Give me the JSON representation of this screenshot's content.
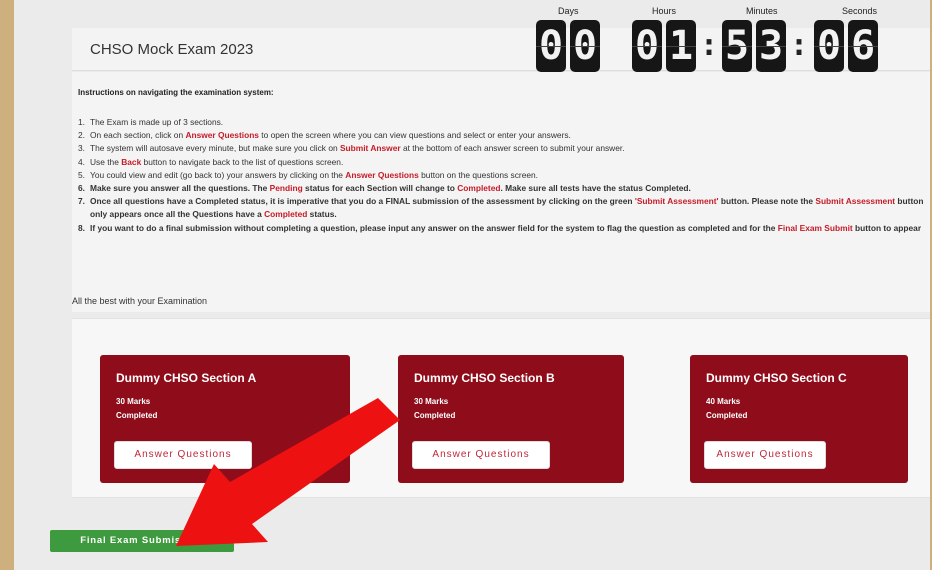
{
  "exam": {
    "title": "CHSO Mock Exam 2023"
  },
  "timer": {
    "labels": {
      "days": "Days",
      "hours": "Hours",
      "minutes": "Minutes",
      "seconds": "Seconds"
    },
    "days": [
      "0",
      "0"
    ],
    "hours": [
      "0",
      "1"
    ],
    "minutes": [
      "5",
      "3"
    ],
    "seconds": [
      "0",
      "6"
    ]
  },
  "instructions": {
    "heading": "Instructions on navigating the examination system:",
    "items": [
      {
        "n": "1.",
        "p": [
          "The Exam is made up of 3 sections."
        ]
      },
      {
        "n": "2.",
        "p": [
          "On each section, click on ",
          "Answer Questions",
          " to open the screen where  you can view questions and select or enter your answers."
        ]
      },
      {
        "n": "3.",
        "p": [
          "The system will autosave every minute, but make sure you click on ",
          "Submit Answer",
          " at the bottom of each answer screen to submit your answer."
        ]
      },
      {
        "n": "4.",
        "p": [
          "Use the ",
          "Back",
          " button to navigate back to the list of questions screen."
        ]
      },
      {
        "n": "5.",
        "p": [
          "You could view and edit (go back to) your answers by clicking on the ",
          "Answer Questions",
          " button on the questions screen."
        ]
      },
      {
        "n": "6.",
        "p": [
          "Make sure you answer all the questions. The ",
          "Pending",
          " status for each Section will change to ",
          "Completed",
          ". Make sure all tests have the status Completed."
        ]
      },
      {
        "n": "7.",
        "p": [
          "Once all questions have a Completed status, it is imperative that you do a FINAL submission of the assessment by clicking on the green ",
          "'Submit Assessment'",
          " button. Please note the ",
          "Submit Assessment",
          " button only appears once all the Questions have a ",
          "Completed",
          " status."
        ]
      },
      {
        "n": "8.",
        "p": [
          "If you want to do a final submission without completing a question, please input any answer on the answer field for the system to flag the question as completed and for the ",
          "Final Exam Submit",
          " button to appear"
        ]
      }
    ],
    "closing": "All the best with your Examination"
  },
  "sections": [
    {
      "title": "Dummy CHSO Section A",
      "marks": "30 Marks",
      "status": "Completed",
      "button": "Answer Questions"
    },
    {
      "title": "Dummy CHSO Section B",
      "marks": "30 Marks",
      "status": "Completed",
      "button": "Answer Questions"
    },
    {
      "title": "Dummy CHSO Section C",
      "marks": "40 Marks",
      "status": "Completed",
      "button": "Answer Questions"
    }
  ],
  "final_submit": {
    "label": "Final Exam Submission"
  },
  "colors": {
    "card": "#8f0c1a",
    "accent_red": "#c41c28",
    "submit_green": "#3e9a3e",
    "arrow": "#ee1111"
  }
}
